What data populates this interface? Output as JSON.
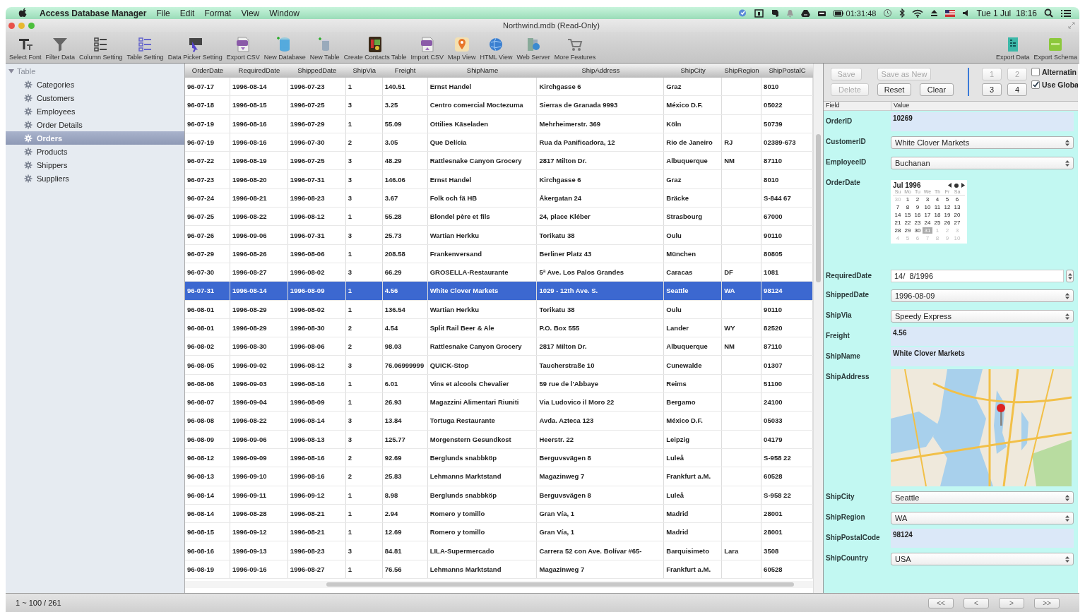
{
  "menubar": {
    "app": "Access Database Manager",
    "menus": [
      "File",
      "Edit",
      "Format",
      "View",
      "Window"
    ],
    "timer": "01:31:48",
    "clock": "Tue 1 Jul  18:16"
  },
  "window": {
    "title": "Northwind.mdb (Read-Only)"
  },
  "toolbar": {
    "left": [
      "Select Font",
      "Filter Data",
      "Column Setting",
      "Table Setting",
      "Data Picker Setting",
      "Export CSV",
      "New Database",
      "New Table",
      "Create Contacts Table",
      "Import CSV",
      "Map View",
      "HTML View",
      "Web Server",
      "More Features"
    ],
    "right": [
      "Export Data",
      "Export Schema"
    ]
  },
  "sidebar": {
    "group": "Table",
    "expanded": true,
    "items": [
      {
        "label": "Categories",
        "selected": false
      },
      {
        "label": "Customers",
        "selected": false
      },
      {
        "label": "Employees",
        "selected": false
      },
      {
        "label": "Order Details",
        "selected": false
      },
      {
        "label": "Orders",
        "selected": true
      },
      {
        "label": "Products",
        "selected": false
      },
      {
        "label": "Shippers",
        "selected": false
      },
      {
        "label": "Suppliers",
        "selected": false
      }
    ]
  },
  "table": {
    "columns": [
      "OrderDate",
      "RequiredDate",
      "ShippedDate",
      "ShipVia",
      "Freight",
      "ShipName",
      "ShipAddress",
      "ShipCity",
      "ShipRegion",
      "ShipPostalC"
    ],
    "rows": [
      {
        "selected": false,
        "cells": [
          "96-07-17",
          "1996-08-14",
          "1996-07-23",
          "1",
          "140.51",
          "Ernst Handel",
          "Kirchgasse 6",
          "Graz",
          null,
          "8010"
        ]
      },
      {
        "selected": false,
        "cells": [
          "96-07-18",
          "1996-08-15",
          "1996-07-25",
          "3",
          "3.25",
          "Centro comercial Moctezuma",
          "Sierras de Granada 9993",
          "México D.F.",
          null,
          "05022"
        ]
      },
      {
        "selected": false,
        "cells": [
          "96-07-19",
          "1996-08-16",
          "1996-07-29",
          "1",
          "55.09",
          "Ottilies Käseladen",
          "Mehrheimerstr. 369",
          "Köln",
          null,
          "50739"
        ]
      },
      {
        "selected": false,
        "cells": [
          "96-07-19",
          "1996-08-16",
          "1996-07-30",
          "2",
          "3.05",
          "Que Delícia",
          "Rua da Panificadora, 12",
          "Rio de Janeiro",
          "RJ",
          "02389-673"
        ]
      },
      {
        "selected": false,
        "cells": [
          "96-07-22",
          "1996-08-19",
          "1996-07-25",
          "3",
          "48.29",
          "Rattlesnake Canyon Grocery",
          "2817 Milton Dr.",
          "Albuquerque",
          "NM",
          "87110"
        ]
      },
      {
        "selected": false,
        "cells": [
          "96-07-23",
          "1996-08-20",
          "1996-07-31",
          "3",
          "146.06",
          "Ernst Handel",
          "Kirchgasse 6",
          "Graz",
          null,
          "8010"
        ]
      },
      {
        "selected": false,
        "cells": [
          "96-07-24",
          "1996-08-21",
          "1996-08-23",
          "3",
          "3.67",
          "Folk och fä HB",
          "Åkergatan 24",
          "Bräcke",
          null,
          "S-844 67"
        ]
      },
      {
        "selected": false,
        "cells": [
          "96-07-25",
          "1996-08-22",
          "1996-08-12",
          "1",
          "55.28",
          "Blondel père et fils",
          "24, place Kléber",
          "Strasbourg",
          null,
          "67000"
        ]
      },
      {
        "selected": false,
        "cells": [
          "96-07-26",
          "1996-09-06",
          "1996-07-31",
          "3",
          "25.73",
          "Wartian Herkku",
          "Torikatu 38",
          "Oulu",
          null,
          "90110"
        ]
      },
      {
        "selected": false,
        "cells": [
          "96-07-29",
          "1996-08-26",
          "1996-08-06",
          "1",
          "208.58",
          "Frankenversand",
          "Berliner Platz 43",
          "München",
          null,
          "80805"
        ]
      },
      {
        "selected": false,
        "cells": [
          "96-07-30",
          "1996-08-27",
          "1996-08-02",
          "3",
          "66.29",
          "GROSELLA-Restaurante",
          "5ª Ave. Los Palos Grandes",
          "Caracas",
          "DF",
          "1081"
        ]
      },
      {
        "selected": true,
        "cells": [
          "96-07-31",
          "1996-08-14",
          "1996-08-09",
          "1",
          "4.56",
          "White Clover Markets",
          "1029 - 12th Ave. S.",
          "Seattle",
          "WA",
          "98124"
        ]
      },
      {
        "selected": false,
        "cells": [
          "96-08-01",
          "1996-08-29",
          "1996-08-02",
          "1",
          "136.54",
          "Wartian Herkku",
          "Torikatu 38",
          "Oulu",
          null,
          "90110"
        ]
      },
      {
        "selected": false,
        "cells": [
          "96-08-01",
          "1996-08-29",
          "1996-08-30",
          "2",
          "4.54",
          "Split Rail Beer & Ale",
          "P.O. Box 555",
          "Lander",
          "WY",
          "82520"
        ]
      },
      {
        "selected": false,
        "cells": [
          "96-08-02",
          "1996-08-30",
          "1996-08-06",
          "2",
          "98.03",
          "Rattlesnake Canyon Grocery",
          "2817 Milton Dr.",
          "Albuquerque",
          "NM",
          "87110"
        ]
      },
      {
        "selected": false,
        "cells": [
          "96-08-05",
          "1996-09-02",
          "1996-08-12",
          "3",
          "76.06999999",
          "QUICK-Stop",
          "Taucherstraße 10",
          "Cunewalde",
          null,
          "01307"
        ]
      },
      {
        "selected": false,
        "cells": [
          "96-08-06",
          "1996-09-03",
          "1996-08-16",
          "1",
          "6.01",
          "Vins et alcools Chevalier",
          "59 rue de l'Abbaye",
          "Reims",
          null,
          "51100"
        ]
      },
      {
        "selected": false,
        "cells": [
          "96-08-07",
          "1996-09-04",
          "1996-08-09",
          "1",
          "26.93",
          "Magazzini Alimentari Riuniti",
          "Via Ludovico il Moro 22",
          "Bergamo",
          null,
          "24100"
        ]
      },
      {
        "selected": false,
        "cells": [
          "96-08-08",
          "1996-08-22",
          "1996-08-14",
          "3",
          "13.84",
          "Tortuga Restaurante",
          "Avda. Azteca 123",
          "México D.F.",
          null,
          "05033"
        ]
      },
      {
        "selected": false,
        "cells": [
          "96-08-09",
          "1996-09-06",
          "1996-08-13",
          "3",
          "125.77",
          "Morgenstern Gesundkost",
          "Heerstr. 22",
          "Leipzig",
          null,
          "04179"
        ]
      },
      {
        "selected": false,
        "cells": [
          "96-08-12",
          "1996-09-09",
          "1996-08-16",
          "2",
          "92.69",
          "Berglunds snabbköp",
          "Berguvsvägen  8",
          "Luleå",
          null,
          "S-958 22"
        ]
      },
      {
        "selected": false,
        "cells": [
          "96-08-13",
          "1996-09-10",
          "1996-08-16",
          "2",
          "25.83",
          "Lehmanns Marktstand",
          "Magazinweg 7",
          "Frankfurt a.M.",
          null,
          "60528"
        ]
      },
      {
        "selected": false,
        "cells": [
          "96-08-14",
          "1996-09-11",
          "1996-09-12",
          "1",
          "8.98",
          "Berglunds snabbköp",
          "Berguvsvägen  8",
          "Luleå",
          null,
          "S-958 22"
        ]
      },
      {
        "selected": false,
        "cells": [
          "96-08-14",
          "1996-08-28",
          "1996-08-21",
          "1",
          "2.94",
          "Romero y tomillo",
          "Gran Vía, 1",
          "Madrid",
          null,
          "28001"
        ]
      },
      {
        "selected": false,
        "cells": [
          "96-08-15",
          "1996-09-12",
          "1996-08-21",
          "1",
          "12.69",
          "Romero y tomillo",
          "Gran Vía, 1",
          "Madrid",
          null,
          "28001"
        ]
      },
      {
        "selected": false,
        "cells": [
          "96-08-16",
          "1996-09-13",
          "1996-08-23",
          "3",
          "84.81",
          "LILA-Supermercado",
          "Carrera 52 con Ave. Bolívar #65-",
          "Barquisimeto",
          "Lara",
          "3508"
        ]
      },
      {
        "selected": false,
        "cells": [
          "96-08-19",
          "1996-09-16",
          "1996-08-27",
          "1",
          "76.56",
          "Lehmanns Marktstand",
          "Magazinweg 7",
          "Frankfurt a.M.",
          null,
          "60528"
        ]
      }
    ]
  },
  "detail": {
    "buttons": [
      {
        "label": "Save",
        "disabled": true
      },
      {
        "label": "Save as New",
        "disabled": true
      },
      {
        "label": "Delete",
        "disabled": true
      },
      {
        "label": "Reset",
        "disabled": false
      },
      {
        "label": "Clear",
        "disabled": false
      }
    ],
    "pages": [
      {
        "label": "1",
        "disabled": true
      },
      {
        "label": "2",
        "disabled": true
      },
      {
        "label": "3",
        "disabled": false
      },
      {
        "label": "4",
        "disabled": false
      }
    ],
    "options": [
      {
        "label": "Alternatin",
        "checked": false
      },
      {
        "label": "Use Globa",
        "checked": true
      }
    ],
    "columns": [
      "Field",
      "Value"
    ],
    "fields": [
      {
        "label": "OrderID",
        "kind": "text",
        "value": "10269"
      },
      {
        "label": "CustomerID",
        "kind": "select",
        "value": "White Clover Markets"
      },
      {
        "label": "EmployeeID",
        "kind": "select",
        "value": "Buchanan"
      },
      {
        "label": "OrderDate",
        "kind": "calendar",
        "calendar": {
          "month": "Jul 1996",
          "weekdays": [
            "Su",
            "Mo",
            "Tu",
            "We",
            "Th",
            "Fr",
            "Sa"
          ],
          "days": [
            {
              "day": "30",
              "muted": true,
              "selected": false
            },
            {
              "day": "1",
              "muted": false,
              "selected": false
            },
            {
              "day": "2",
              "muted": false,
              "selected": false
            },
            {
              "day": "3",
              "muted": false,
              "selected": false
            },
            {
              "day": "4",
              "muted": false,
              "selected": false
            },
            {
              "day": "5",
              "muted": false,
              "selected": false
            },
            {
              "day": "6",
              "muted": false,
              "selected": false
            },
            {
              "day": "7",
              "muted": false,
              "selected": false
            },
            {
              "day": "8",
              "muted": false,
              "selected": false
            },
            {
              "day": "9",
              "muted": false,
              "selected": false
            },
            {
              "day": "10",
              "muted": false,
              "selected": false
            },
            {
              "day": "11",
              "muted": false,
              "selected": false
            },
            {
              "day": "12",
              "muted": false,
              "selected": false
            },
            {
              "day": "13",
              "muted": false,
              "selected": false
            },
            {
              "day": "14",
              "muted": false,
              "selected": false
            },
            {
              "day": "15",
              "muted": false,
              "selected": false
            },
            {
              "day": "16",
              "muted": false,
              "selected": false
            },
            {
              "day": "17",
              "muted": false,
              "selected": false
            },
            {
              "day": "18",
              "muted": false,
              "selected": false
            },
            {
              "day": "19",
              "muted": false,
              "selected": false
            },
            {
              "day": "20",
              "muted": false,
              "selected": false
            },
            {
              "day": "21",
              "muted": false,
              "selected": false
            },
            {
              "day": "22",
              "muted": false,
              "selected": false
            },
            {
              "day": "23",
              "muted": false,
              "selected": false
            },
            {
              "day": "24",
              "muted": false,
              "selected": false
            },
            {
              "day": "25",
              "muted": false,
              "selected": false
            },
            {
              "day": "26",
              "muted": false,
              "selected": false
            },
            {
              "day": "27",
              "muted": false,
              "selected": false
            },
            {
              "day": "28",
              "muted": false,
              "selected": false
            },
            {
              "day": "29",
              "muted": false,
              "selected": false
            },
            {
              "day": "30",
              "muted": false,
              "selected": false
            },
            {
              "day": "31",
              "muted": false,
              "selected": true
            },
            {
              "day": "1",
              "muted": true,
              "selected": false
            },
            {
              "day": "2",
              "muted": true,
              "selected": false
            },
            {
              "day": "3",
              "muted": true,
              "selected": false
            },
            {
              "day": "4",
              "muted": true,
              "selected": false
            },
            {
              "day": "5",
              "muted": true,
              "selected": false
            },
            {
              "day": "6",
              "muted": true,
              "selected": false
            },
            {
              "day": "7",
              "muted": true,
              "selected": false
            },
            {
              "day": "8",
              "muted": true,
              "selected": false
            },
            {
              "day": "9",
              "muted": true,
              "selected": false
            },
            {
              "day": "10",
              "muted": true,
              "selected": false
            }
          ]
        }
      },
      {
        "label": "RequiredDate",
        "kind": "stepper",
        "value": "14/  8/1996"
      },
      {
        "label": "ShippedDate",
        "kind": "select",
        "value": "1996-08-09"
      },
      {
        "label": "ShipVia",
        "kind": "select",
        "value": "Speedy Express"
      },
      {
        "label": "Freight",
        "kind": "text",
        "value": "4.56"
      },
      {
        "label": "ShipName",
        "kind": "text",
        "value": "White Clover Markets"
      },
      {
        "label": "ShipAddress",
        "kind": "map"
      },
      {
        "label": "ShipCity",
        "kind": "select",
        "value": "Seattle"
      },
      {
        "label": "ShipRegion",
        "kind": "select",
        "value": "WA"
      },
      {
        "label": "ShipPostalCode",
        "kind": "text",
        "value": "98124"
      },
      {
        "label": "ShipCountry",
        "kind": "select",
        "value": "USA"
      }
    ]
  },
  "status_bar": {
    "range": "1 ~ 100 / 261",
    "nav": [
      "<<",
      "<",
      ">",
      ">>"
    ]
  }
}
